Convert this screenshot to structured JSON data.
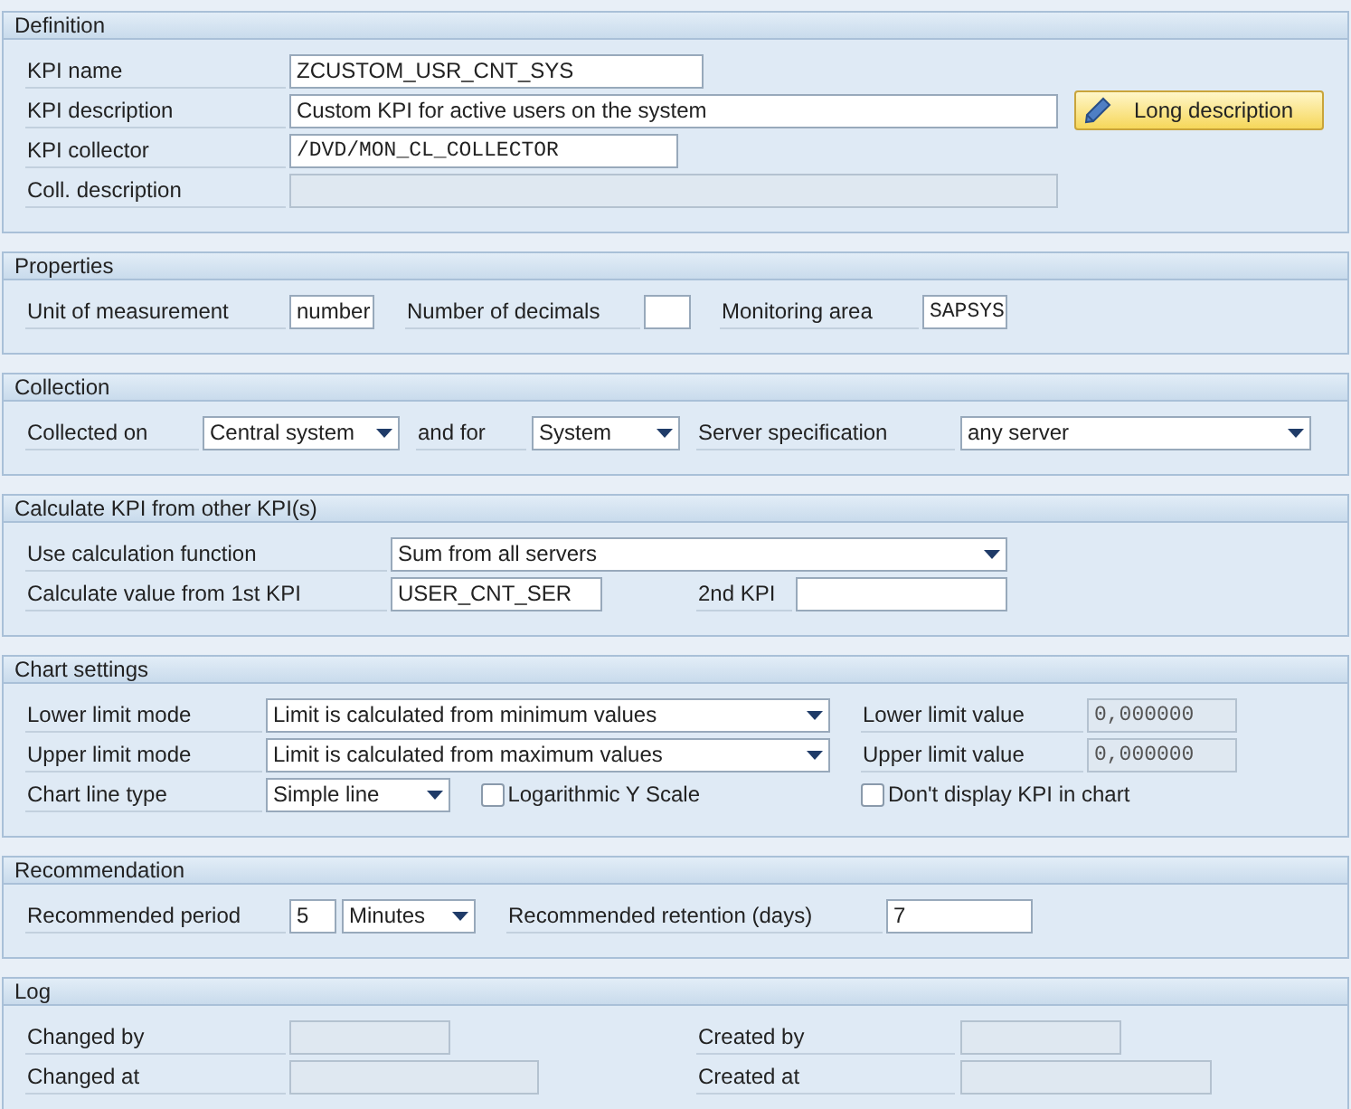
{
  "sections": [
    {
      "title": "Definition",
      "rows": [
        {
          "items": [
            {
              "kind": "label",
              "text": "KPI name"
            },
            {
              "kind": "field",
              "value": "ZCUSTOM_USR_CNT_SYS",
              "disabled": false
            }
          ]
        },
        {
          "items": [
            {
              "kind": "label",
              "text": "KPI description"
            },
            {
              "kind": "field",
              "value": "Custom KPI for active users on the system",
              "disabled": false
            },
            {
              "kind": "button",
              "label": "Long description"
            }
          ]
        },
        {
          "items": [
            {
              "kind": "label",
              "text": "KPI collector"
            },
            {
              "kind": "code_field",
              "value": "/DVD/MON_CL_COLLECTOR",
              "disabled": false
            }
          ]
        },
        {
          "items": [
            {
              "kind": "label",
              "text": "Coll. description"
            },
            {
              "kind": "field",
              "value": "",
              "disabled": true
            }
          ]
        }
      ]
    },
    {
      "title": "Properties",
      "rows": [
        {
          "items": [
            {
              "kind": "label",
              "text": "Unit of measurement"
            },
            {
              "kind": "field",
              "value": "number",
              "disabled": false
            },
            {
              "kind": "label",
              "text": "Number of decimals"
            },
            {
              "kind": "field",
              "value": "",
              "disabled": false
            },
            {
              "kind": "label",
              "text": "Monitoring area"
            },
            {
              "kind": "code_field",
              "value": "SAPSYS",
              "disabled": false
            }
          ]
        }
      ]
    },
    {
      "title": "Collection",
      "rows": [
        {
          "items": [
            {
              "kind": "label",
              "text": "Collected on"
            },
            {
              "kind": "dropdown",
              "value": "Central system"
            },
            {
              "kind": "label",
              "text": "and for"
            },
            {
              "kind": "dropdown",
              "value": "System"
            },
            {
              "kind": "label",
              "text": "Server specification"
            },
            {
              "kind": "dropdown",
              "value": "any server"
            }
          ]
        }
      ]
    },
    {
      "title": "Calculate KPI from other KPI(s)",
      "rows": [
        {
          "items": [
            {
              "kind": "label",
              "text": "Use calculation function"
            },
            {
              "kind": "dropdown",
              "value": "Sum from all servers"
            }
          ]
        },
        {
          "items": [
            {
              "kind": "label",
              "text": "Calculate value from 1st KPI"
            },
            {
              "kind": "field",
              "value": "USER_CNT_SER",
              "disabled": false
            },
            {
              "kind": "label",
              "text": "2nd KPI"
            },
            {
              "kind": "field",
              "value": "",
              "disabled": false
            }
          ]
        }
      ]
    },
    {
      "title": "Chart settings",
      "rows": [
        {
          "items": [
            {
              "kind": "label",
              "text": "Lower limit mode"
            },
            {
              "kind": "dropdown",
              "value": "Limit is calculated from minimum values"
            },
            {
              "kind": "label",
              "text": "Lower limit value"
            },
            {
              "kind": "code_field",
              "value": "0,000000",
              "disabled": true
            }
          ]
        },
        {
          "items": [
            {
              "kind": "label",
              "text": "Upper limit mode"
            },
            {
              "kind": "dropdown",
              "value": "Limit is calculated from maximum values"
            },
            {
              "kind": "label",
              "text": "Upper limit value"
            },
            {
              "kind": "code_field",
              "value": "0,000000",
              "disabled": true
            }
          ]
        },
        {
          "items": [
            {
              "kind": "label",
              "text": "Chart line type"
            },
            {
              "kind": "dropdown",
              "value": "Simple line"
            },
            {
              "kind": "checkbox",
              "label": "Logarithmic Y Scale",
              "checked": false
            },
            {
              "kind": "checkbox",
              "label": "Don't display KPI in chart",
              "checked": false
            }
          ]
        }
      ]
    },
    {
      "title": "Recommendation",
      "rows": [
        {
          "items": [
            {
              "kind": "label",
              "text": "Recommended period"
            },
            {
              "kind": "field",
              "value": "5",
              "disabled": false
            },
            {
              "kind": "dropdown",
              "value": "Minutes"
            },
            {
              "kind": "label",
              "text": "Recommended retention (days)"
            },
            {
              "kind": "field",
              "value": "7",
              "disabled": false
            }
          ]
        }
      ]
    },
    {
      "title": "Log",
      "rows": [
        {
          "items": [
            {
              "kind": "label",
              "text": "Changed by"
            },
            {
              "kind": "field",
              "value": "",
              "disabled": true
            },
            {
              "kind": "label",
              "text": "Created by"
            },
            {
              "kind": "field",
              "value": "",
              "disabled": true
            }
          ]
        },
        {
          "items": [
            {
              "kind": "label",
              "text": "Changed at"
            },
            {
              "kind": "field",
              "value": "",
              "disabled": true
            },
            {
              "kind": "label",
              "text": "Created at"
            },
            {
              "kind": "field",
              "value": "",
              "disabled": true
            }
          ]
        }
      ]
    }
  ]
}
